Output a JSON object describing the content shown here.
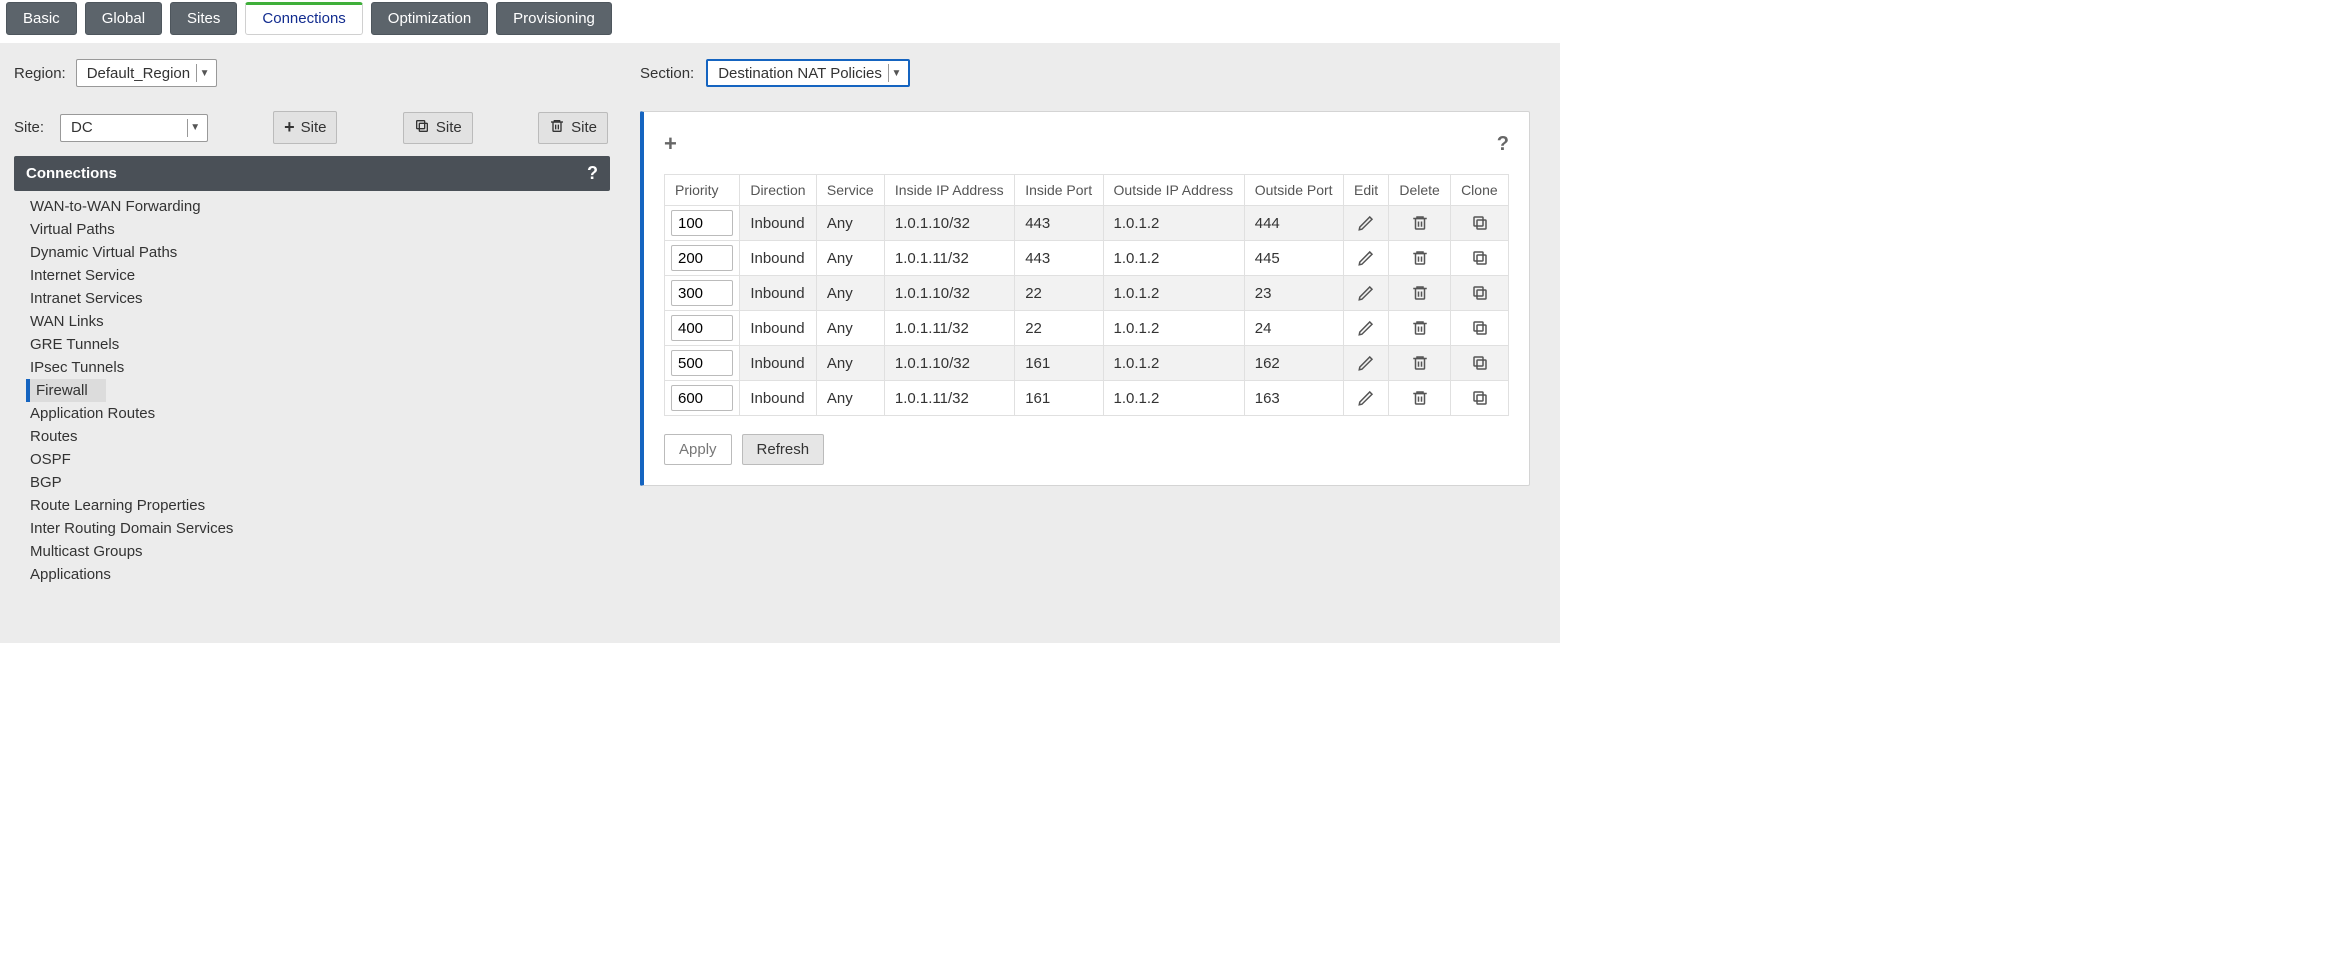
{
  "tabs": [
    "Basic",
    "Global",
    "Sites",
    "Connections",
    "Optimization",
    "Provisioning"
  ],
  "active_tab": "Connections",
  "region_label": "Region:",
  "region_value": "Default_Region",
  "site_label": "Site:",
  "site_value": "DC",
  "sitebtn_add": "Site",
  "sitebtn_clone": "Site",
  "sitebtn_delete": "Site",
  "panel_title": "Connections",
  "help_symbol": "?",
  "nav": [
    "WAN-to-WAN Forwarding",
    "Virtual Paths",
    "Dynamic Virtual Paths",
    "Internet Service",
    "Intranet Services",
    "WAN Links",
    "GRE Tunnels",
    "IPsec Tunnels",
    "Firewall",
    "Application Routes",
    "Routes",
    "OSPF",
    "BGP",
    "Route Learning Properties",
    "Inter Routing Domain Services",
    "Multicast Groups",
    "Applications"
  ],
  "nav_selected": "Firewall",
  "section_label": "Section:",
  "section_value": "Destination NAT Policies",
  "add_symbol": "+",
  "columns": [
    "Priority",
    "Direction",
    "Service",
    "Inside IP Address",
    "Inside Port",
    "Outside IP Address",
    "Outside Port",
    "Edit",
    "Delete",
    "Clone"
  ],
  "rows": [
    {
      "priority": "100",
      "direction": "Inbound",
      "service": "Any",
      "inside_ip": "1.0.1.10/32",
      "inside_port": "443",
      "outside_ip": "1.0.1.2",
      "outside_port": "444"
    },
    {
      "priority": "200",
      "direction": "Inbound",
      "service": "Any",
      "inside_ip": "1.0.1.11/32",
      "inside_port": "443",
      "outside_ip": "1.0.1.2",
      "outside_port": "445"
    },
    {
      "priority": "300",
      "direction": "Inbound",
      "service": "Any",
      "inside_ip": "1.0.1.10/32",
      "inside_port": "22",
      "outside_ip": "1.0.1.2",
      "outside_port": "23"
    },
    {
      "priority": "400",
      "direction": "Inbound",
      "service": "Any",
      "inside_ip": "1.0.1.11/32",
      "inside_port": "22",
      "outside_ip": "1.0.1.2",
      "outside_port": "24"
    },
    {
      "priority": "500",
      "direction": "Inbound",
      "service": "Any",
      "inside_ip": "1.0.1.10/32",
      "inside_port": "161",
      "outside_ip": "1.0.1.2",
      "outside_port": "162"
    },
    {
      "priority": "600",
      "direction": "Inbound",
      "service": "Any",
      "inside_ip": "1.0.1.11/32",
      "inside_port": "161",
      "outside_ip": "1.0.1.2",
      "outside_port": "163"
    }
  ],
  "apply_label": "Apply",
  "refresh_label": "Refresh"
}
